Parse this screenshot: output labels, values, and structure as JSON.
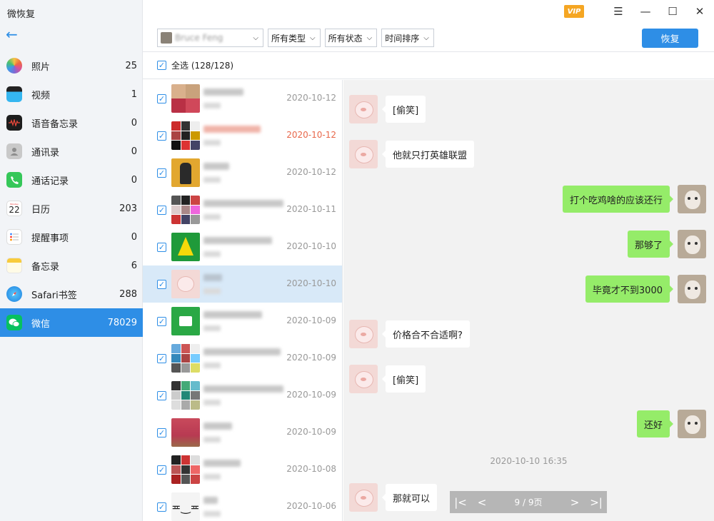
{
  "app": {
    "title": "微恢复"
  },
  "sidebar": {
    "items": [
      {
        "label": "照片",
        "count": "25"
      },
      {
        "label": "视频",
        "count": "1"
      },
      {
        "label": "语音备忘录",
        "count": "0"
      },
      {
        "label": "通讯录",
        "count": "0"
      },
      {
        "label": "通话记录",
        "count": "0"
      },
      {
        "label": "日历",
        "count": "203",
        "icon_text": "22",
        "icon_subtext": "Monday"
      },
      {
        "label": "提醒事项",
        "count": "0"
      },
      {
        "label": "备忘录",
        "count": "6"
      },
      {
        "label": "Safari书签",
        "count": "288"
      },
      {
        "label": "微信",
        "count": "78029"
      }
    ]
  },
  "toolbar": {
    "vip": "VIP",
    "user_dropdown": "Bruce Feng",
    "filters": [
      "所有类型",
      "所有状态",
      "时间排序"
    ],
    "restore_label": "恢复"
  },
  "select_all": {
    "label": "全选 (128/128)",
    "check": "✓"
  },
  "conversations": [
    {
      "date": "2020-10-12"
    },
    {
      "date": "2020-10-12"
    },
    {
      "date": "2020-10-12"
    },
    {
      "date": "2020-10-11"
    },
    {
      "date": "2020-10-10"
    },
    {
      "date": "2020-10-10"
    },
    {
      "date": "2020-10-09"
    },
    {
      "date": "2020-10-09"
    },
    {
      "date": "2020-10-09"
    },
    {
      "date": "2020-10-09"
    },
    {
      "date": "2020-10-08"
    },
    {
      "date": "2020-10-06"
    }
  ],
  "chat": {
    "messages": [
      {
        "text": "[偷笑]"
      },
      {
        "text": "他就只打英雄联盟"
      },
      {
        "text": "打个吃鸡啥的应该还行"
      },
      {
        "text": "那够了"
      },
      {
        "text": "毕竟才不到3000"
      },
      {
        "text": "价格合不合适啊?"
      },
      {
        "text": "[偷笑]"
      },
      {
        "text": "还好"
      },
      {
        "text": "那就可以"
      }
    ],
    "timestamp": "2020-10-10 16:35"
  },
  "pager": {
    "info": "9 /  9页"
  },
  "colors": {
    "accent": "#2e8ee6",
    "bubble_self": "#95ec69",
    "vip": "#f5a623"
  }
}
